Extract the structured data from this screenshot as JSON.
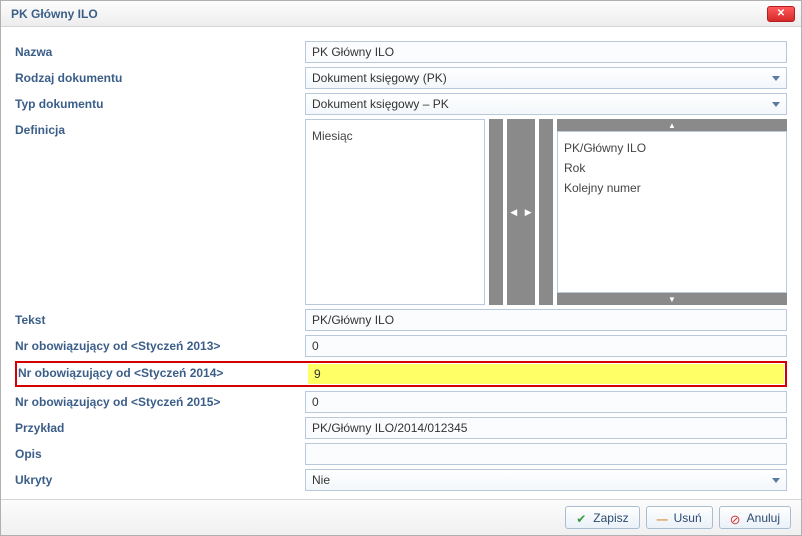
{
  "window": {
    "title": "PK Główny ILO"
  },
  "labels": {
    "nazwa": "Nazwa",
    "rodzaj": "Rodzaj dokumentu",
    "typ": "Typ dokumentu",
    "definicja": "Definicja",
    "tekst": "Tekst",
    "nr2013": "Nr obowiązujący od <Styczeń 2013>",
    "nr2014": "Nr obowiązujący od <Styczeń 2014>",
    "nr2015": "Nr obowiązujący od <Styczeń 2015>",
    "przyklad": "Przykład",
    "opis": "Opis",
    "ukryty": "Ukryty"
  },
  "values": {
    "nazwa": "PK Główny ILO",
    "rodzaj": "Dokument księgowy (PK)",
    "typ": "Dokument księgowy – PK",
    "tekst": "PK/Główny ILO",
    "nr2013": "0",
    "nr2014": "9",
    "nr2015": "0",
    "przyklad": "PK/Główny ILO/2014/012345",
    "opis": "",
    "ukryty": "Nie"
  },
  "definicja": {
    "left": [
      "Miesiąc"
    ],
    "right": [
      "PK/Główny ILO",
      "Rok",
      "Kolejny numer"
    ]
  },
  "buttons": {
    "zapisz": "Zapisz",
    "usun": "Usuń",
    "anuluj": "Anuluj"
  }
}
